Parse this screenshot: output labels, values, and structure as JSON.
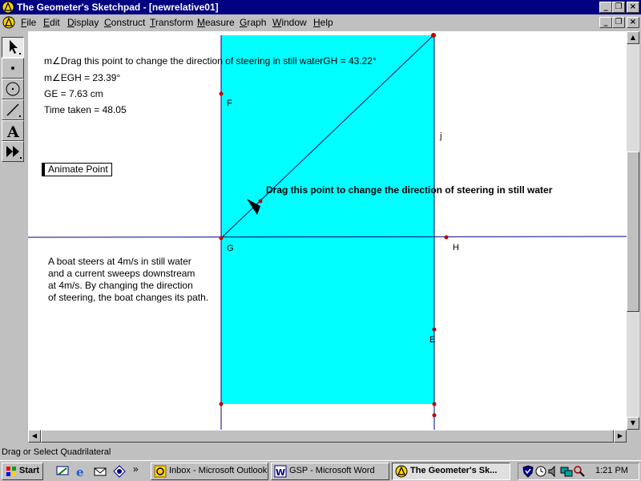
{
  "window": {
    "title": "The Geometer's Sketchpad - [newrelative01]"
  },
  "menu": [
    "File",
    "Edit",
    "Display",
    "Construct",
    "Transform",
    "Measure",
    "Graph",
    "Window",
    "Help"
  ],
  "menu_accel": [
    "F",
    "E",
    "D",
    "C",
    "T",
    "M",
    "G",
    "W",
    "H"
  ],
  "toolbox": [
    "pointer-tool",
    "point-tool",
    "compass-tool",
    "straightedge-tool",
    "text-tool",
    "script-tool"
  ],
  "measurements": {
    "line1": "m∠Drag this point to change the direction of steering in still waterGH = 43.22°",
    "line2": "m∠EGH = 23.39°",
    "line3": "GE = 7.63 cm",
    "line4": "Time taken = 48.05"
  },
  "animate_button": "Animate Point",
  "caption": "Drag this point to change the direction of steering in still water",
  "description": [
    "A boat steers at 4m/s in still water",
    "and a current sweeps downstream",
    "at 4m/s. By changing the direction",
    "of steering, the boat changes its path."
  ],
  "labels": {
    "F": "F",
    "j": "j",
    "G": "G",
    "H": "H",
    "E": "E"
  },
  "colors": {
    "river": "#00ffff",
    "line": "#000080",
    "point": "#c00000",
    "titlebar": "#000080"
  },
  "status": "Drag or Select Quadrilateral",
  "taskbar": {
    "start": "Start",
    "buttons": [
      "Inbox - Microsoft Outlook",
      "GSP - Microsoft Word",
      "The Geometer's Sk..."
    ],
    "clock": "1:21 PM"
  }
}
